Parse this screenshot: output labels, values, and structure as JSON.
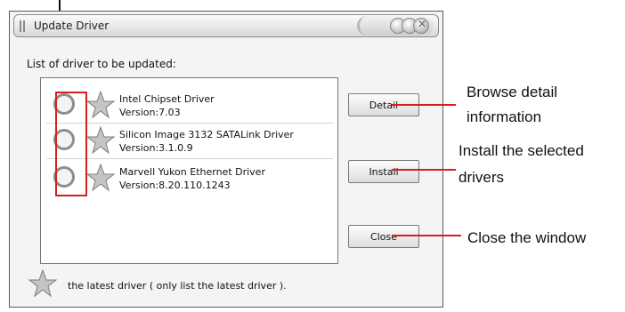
{
  "window": {
    "title": "Update Driver",
    "list_label": "List of driver to be updated:",
    "drivers": [
      {
        "name": "Intel Chipset Driver",
        "version": "Version:7.03"
      },
      {
        "name": "Silicon Image 3132 SATALink Driver",
        "version": "Version:3.1.0.9"
      },
      {
        "name": "Marvell Yukon Ethernet Driver",
        "version": "Version:8.20.110.1243"
      }
    ],
    "buttons": {
      "detail": "Detail",
      "install": "Install",
      "close": "Close"
    },
    "legend": "the latest driver ( only list the latest driver )."
  },
  "annotations": {
    "detail": "Browse detail",
    "detail_line2": "information",
    "install": "Install the selected",
    "install_line2": "drivers",
    "close": "Close the window"
  },
  "colors": {
    "annotation_accent": "#d81e1e",
    "star": "#b9b9b9"
  },
  "icons": {
    "driver_marker": "star-icon",
    "selector": "radio-icon"
  }
}
